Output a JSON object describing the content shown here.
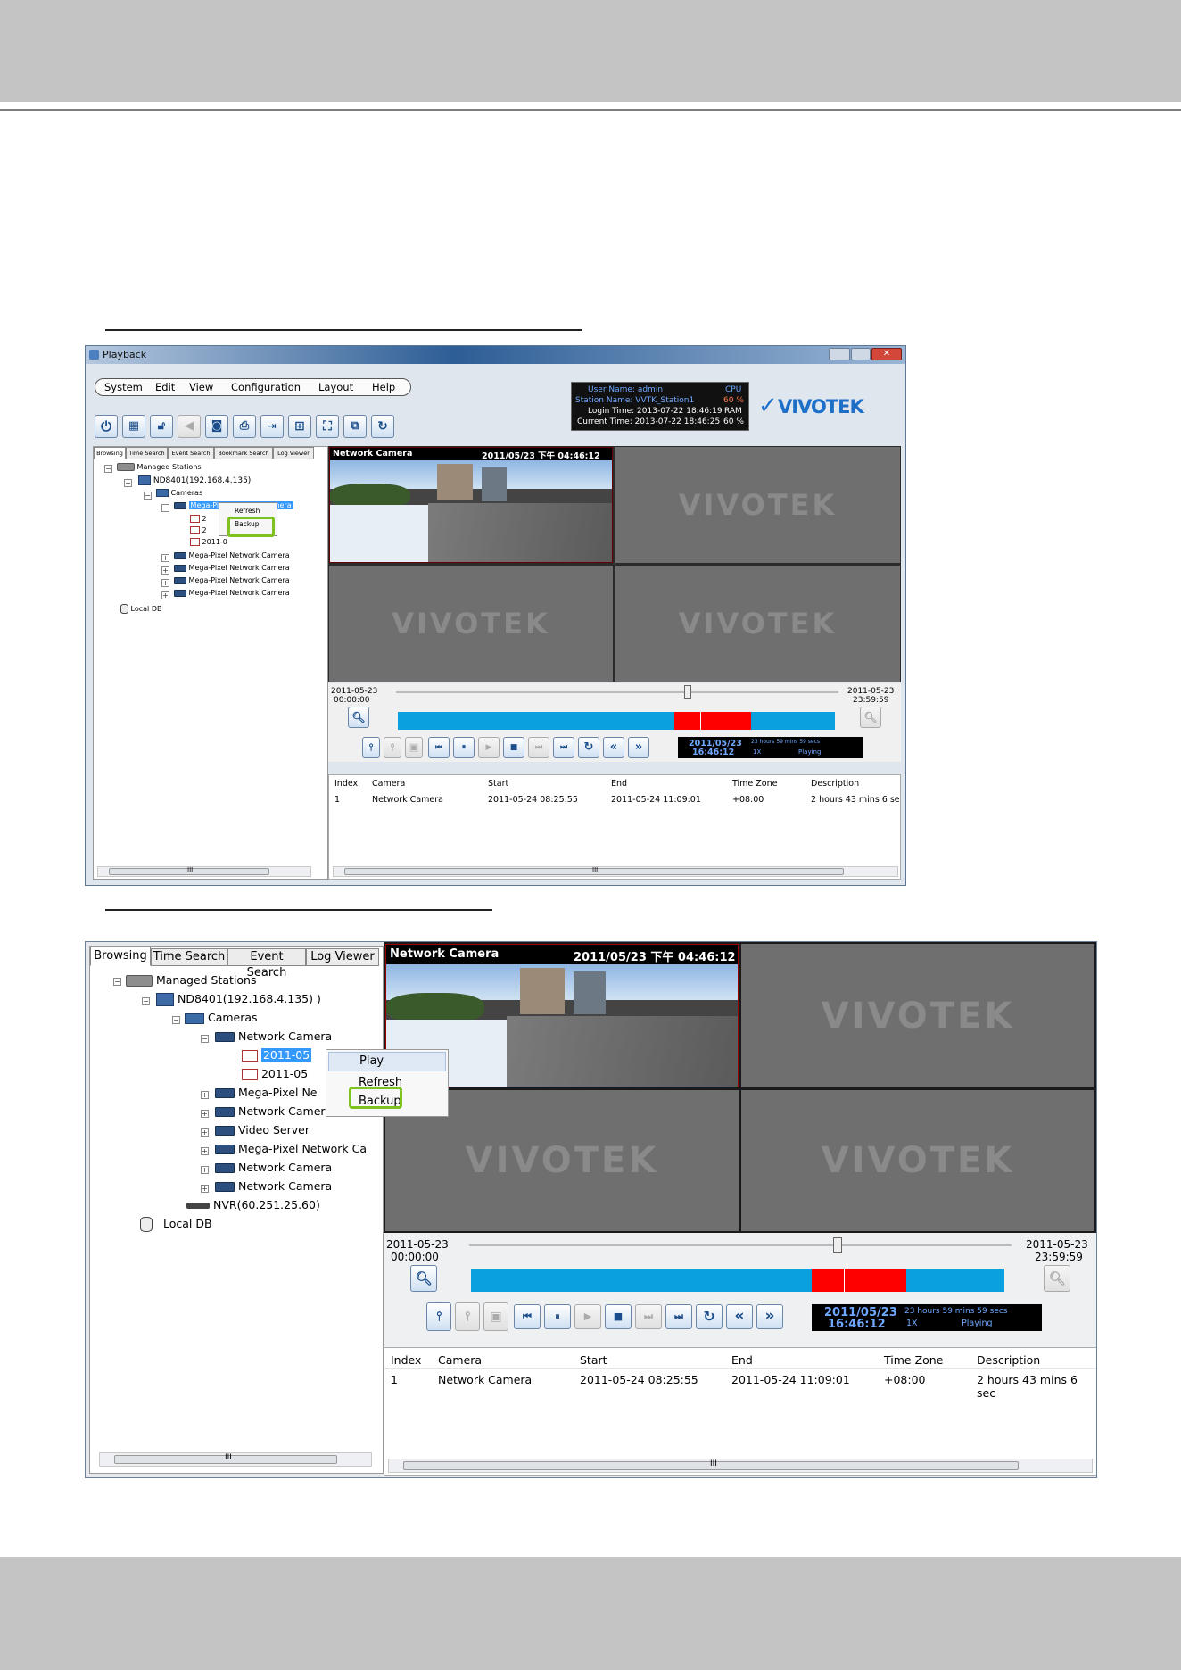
{
  "top": {
    "title": "Playback",
    "menu": [
      "System",
      "Edit",
      "View",
      "Configuration",
      "Layout",
      "Help"
    ],
    "status": {
      "user_name": "User Name: admin",
      "station_name": "Station Name: VVTK_Station1",
      "login_time": "Login Time: 2013-07-22 18:46:19",
      "current_time": "Current Time: 2013-07-22 18:46:25",
      "cpu_label": "CPU",
      "cpu_value": "60 %",
      "ram_label": "RAM",
      "ram_value": "60 %"
    },
    "brand": "VIVOTEK",
    "tabs": [
      "Browsing",
      "Time Search",
      "Event Search",
      "Bookmark Search",
      "Log Viewer"
    ],
    "tree": {
      "managed": "Managed Stations",
      "station": "ND8401(192.168.4.135)",
      "cameras": "Cameras",
      "camera_selected": "Mega-Pixel Network Camera",
      "rec1": "2",
      "rec2": "2",
      "rec3": "2011-0",
      "others": [
        "Mega-Pixel Network Camera",
        "Mega-Pixel Network Camera",
        "Mega-Pixel Network Camera",
        "Mega-Pixel Network Camera"
      ],
      "localdb": "Local DB"
    },
    "context_menu": [
      "Refresh",
      "Backup"
    ],
    "video": {
      "camera_name": "Network Camera",
      "timestamp": "2011/05/23 下午 04:46:12",
      "watermark": "VIVOTEK"
    },
    "timeline": {
      "start_date": "2011-05-23",
      "start_time": "00:00:00",
      "end_date": "2011-05-23",
      "end_time": "23:59:59",
      "position": 0.66
    },
    "playinfo": {
      "date": "2011/05/23",
      "time": "16:46:12",
      "remaining": "23 hours 59 mins 59 secs",
      "speed": "1X",
      "state": "Playing"
    },
    "table": {
      "headers": [
        "Index",
        "Camera",
        "Start",
        "End",
        "Time Zone",
        "Description"
      ],
      "row": [
        "1",
        "Network Camera",
        "2011-05-24 08:25:55",
        "2011-05-24 11:09:01",
        "+08:00",
        "2 hours 43 mins 6 se"
      ]
    },
    "scroll_glyph": "III"
  },
  "bottom": {
    "tabs": [
      "Browsing",
      "Time Search",
      "Event Search",
      "Log Viewer"
    ],
    "tree": {
      "managed": "Managed Stations",
      "station": "ND8401(192.168.4.135)  )",
      "cameras": "Cameras",
      "network_camera": "Network Camera",
      "rec1": "2011-05",
      "rec2": "2011-05",
      "others": [
        "Mega-Pixel Ne",
        "Network Camera",
        "Video Server",
        "Mega-Pixel Network Ca",
        "Network Camera",
        "Network Camera"
      ],
      "nvr": "NVR(60.251.25.60)",
      "localdb": "Local DB"
    },
    "context_menu": [
      "Play",
      "Refresh",
      "Backup"
    ],
    "video": {
      "camera_name": "Network Camera",
      "timestamp": "2011/05/23 下午 04:46:12",
      "watermark": "VIVOTEK"
    },
    "timeline": {
      "start_date": "2011-05-23",
      "start_time": "00:00:00",
      "end_date": "2011-05-23",
      "end_time": "23:59:59",
      "position": 0.68
    },
    "playinfo": {
      "date": "2011/05/23",
      "time": "16:46:12",
      "remaining": "23 hours 59 mins 59 secs",
      "speed": "1X",
      "state": "Playing"
    },
    "table": {
      "headers": [
        "Index",
        "Camera",
        "Start",
        "End",
        "Time Zone",
        "Description"
      ],
      "row": [
        "1",
        "Network Camera",
        "2011-05-24 08:25:55",
        "2011-05-24 11:09:01",
        "+08:00",
        "2 hours 43 mins 6 sec"
      ]
    },
    "scroll_glyph": "III"
  },
  "colors": {
    "timeline": "#0aa0e0",
    "recording": "#ff0000",
    "highlight_box": "#7dc21e",
    "selection": "#3399ff"
  }
}
